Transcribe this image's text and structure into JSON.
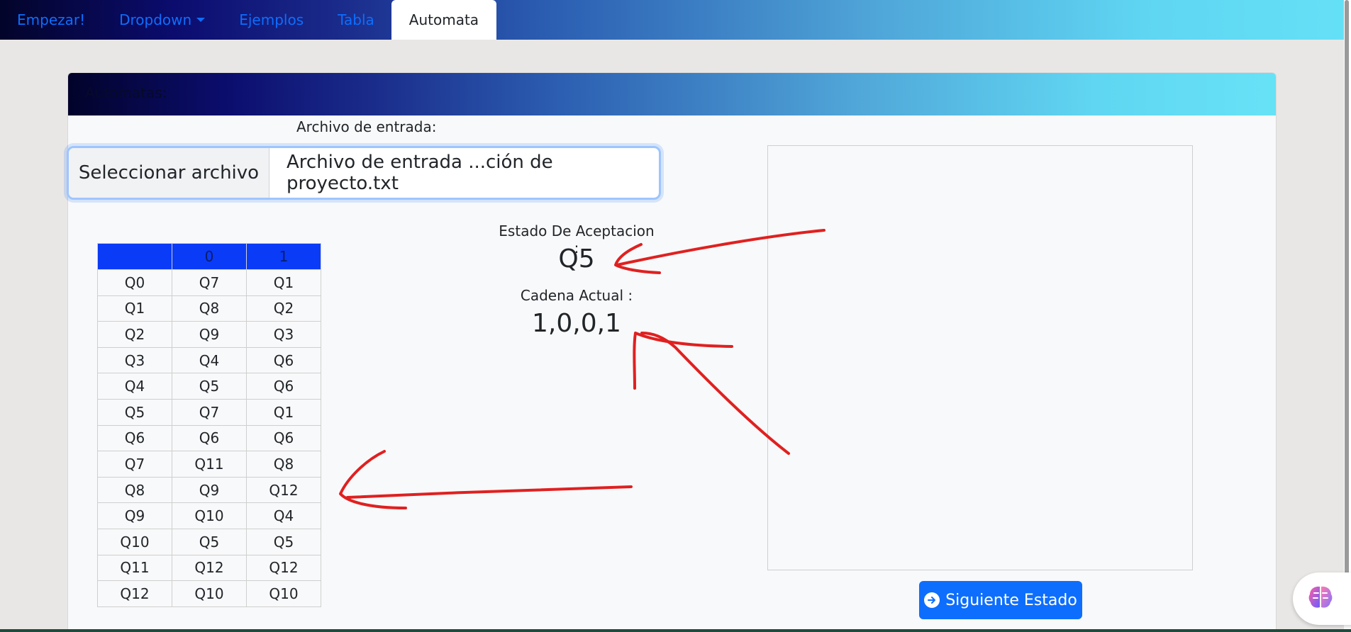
{
  "nav": {
    "items": [
      {
        "label": "Empezar!",
        "active": false
      },
      {
        "label": "Dropdown",
        "active": false,
        "has_caret": true
      },
      {
        "label": "Ejemplos",
        "active": false
      },
      {
        "label": "Tabla",
        "active": false
      },
      {
        "label": "Automata",
        "active": true
      }
    ]
  },
  "card": {
    "header_title": "Automatas:"
  },
  "file": {
    "label": "Archivo de entrada:",
    "button_label": "Seleccionar archivo",
    "file_name": "Archivo de entrada ...ción de proyecto.txt"
  },
  "table": {
    "headers": [
      "",
      "0",
      "1"
    ],
    "rows": [
      [
        "Q0",
        "Q7",
        "Q1"
      ],
      [
        "Q1",
        "Q8",
        "Q2"
      ],
      [
        "Q2",
        "Q9",
        "Q3"
      ],
      [
        "Q3",
        "Q4",
        "Q6"
      ],
      [
        "Q4",
        "Q5",
        "Q6"
      ],
      [
        "Q5",
        "Q7",
        "Q1"
      ],
      [
        "Q6",
        "Q6",
        "Q6"
      ],
      [
        "Q7",
        "Q11",
        "Q8"
      ],
      [
        "Q8",
        "Q9",
        "Q12"
      ],
      [
        "Q9",
        "Q10",
        "Q4"
      ],
      [
        "Q10",
        "Q5",
        "Q5"
      ],
      [
        "Q11",
        "Q12",
        "Q12"
      ],
      [
        "Q12",
        "Q10",
        "Q10"
      ]
    ]
  },
  "status": {
    "accept_label": "Estado De Aceptacion :",
    "accept_value": "Q5",
    "chain_label": "Cadena Actual :",
    "chain_value": "1,0,0,1"
  },
  "actions": {
    "next_label": "Siguiente Estado"
  },
  "colors": {
    "primary": "#0d6efd",
    "table_header": "#0a3bf7",
    "annotation": "#e02020"
  },
  "icons": {
    "next": "arrow-circle-right-icon",
    "assistant": "brain-icon"
  }
}
